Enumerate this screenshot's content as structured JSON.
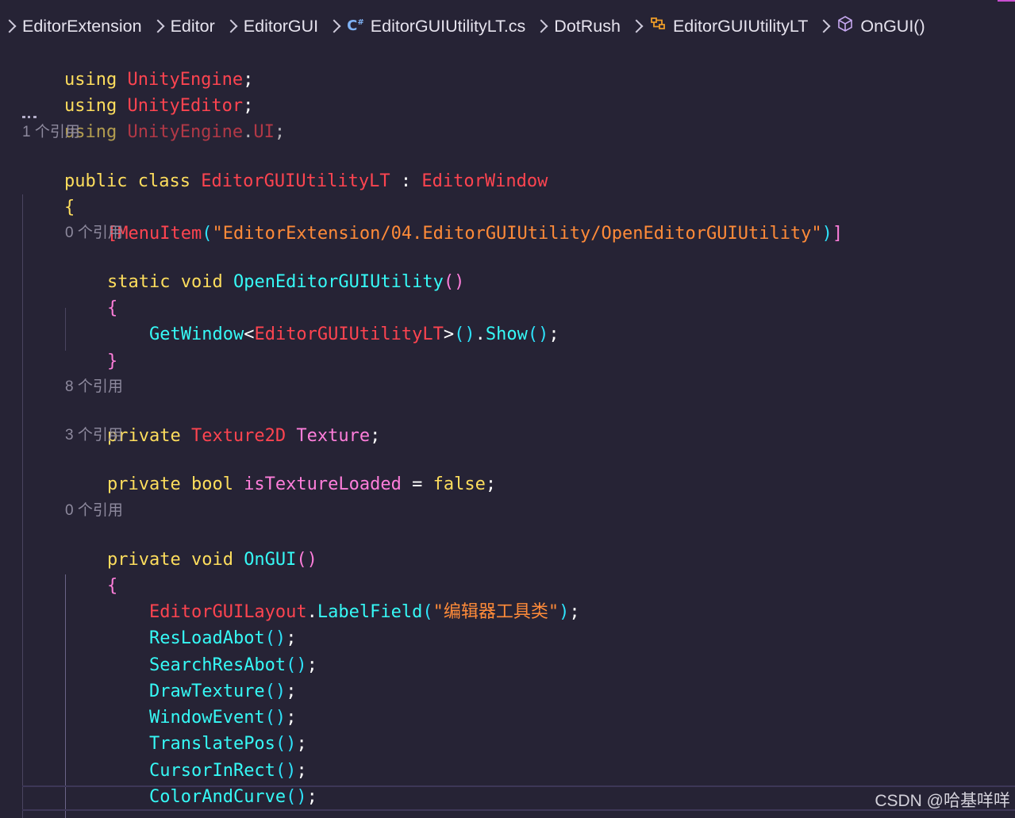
{
  "breadcrumb": {
    "items": [
      "EditorExtension",
      "Editor",
      "EditorGUI",
      "EditorGUIUtilityLT.cs",
      "DotRush",
      "EditorGUIUtilityLT",
      "OnGUI()"
    ],
    "icons": {
      "file": "csharp-file-icon",
      "class": "class-icon",
      "method": "method-cube-icon"
    }
  },
  "code": {
    "using1": {
      "kw": "using",
      "ns": "UnityEngine",
      "end": ";"
    },
    "using2": {
      "kw": "using",
      "ns": "UnityEditor",
      "end": ";"
    },
    "using3": {
      "kw": "using",
      "ns_a": "UnityEngine",
      "dot": ".",
      "ns_b": "UI",
      "end": ";"
    },
    "lens_class": "1 个引用",
    "class_decl": {
      "kw1": "public",
      "kw2": "class",
      "name": "EditorGUIUtilityLT",
      "colon": " : ",
      "base": "EditorWindow"
    },
    "open_brace": "{",
    "attr": {
      "open": "[",
      "name": "MenuItem",
      "paren_open": "(",
      "string": "\"EditorExtension/04.EditorGUIUtility/OpenEditorGUIUtility\"",
      "paren_close": ")",
      "close": "]"
    },
    "lens_open": "0 个引用",
    "open_method": {
      "kw1": "static",
      "kw2": "void",
      "name": "OpenEditorGUIUtility",
      "parens": "()"
    },
    "open_body_brace": "{",
    "getwindow": {
      "fn": "GetWindow",
      "lt": "<",
      "type": "EditorGUIUtilityLT",
      "gt": ">",
      "parens1": "()",
      "dot": ".",
      "fn2": "Show",
      "parens2": "()",
      "end": ";"
    },
    "open_body_close": "}",
    "lens_texture": "8 个引用",
    "texture_field": {
      "kw": "private",
      "type": "Texture2D",
      "name": "Texture",
      "end": ";"
    },
    "lens_loaded": "3 个引用",
    "loaded_field": {
      "kw1": "private",
      "kw2": "bool",
      "name": "isTextureLoaded",
      "eq": " = ",
      "val": "false",
      "end": ";"
    },
    "lens_ongui": "0 个引用",
    "ongui_decl": {
      "kw1": "private",
      "kw2": "void",
      "name": "OnGUI",
      "parens": "()"
    },
    "ongui_brace": "{",
    "label": {
      "cls": "EditorGUILayout",
      "dot": ".",
      "fn": "LabelField",
      "paren_open": "(",
      "string": "\"编辑器工具类\"",
      "paren_close": ")",
      "end": ";"
    },
    "calls": [
      "ResLoadAbot",
      "SearchResAbot",
      "DrawTexture",
      "WindowEvent",
      "TranslatePos",
      "CursorInRect",
      "ColorAndCurve"
    ],
    "call_parens": "()",
    "call_end": ";"
  },
  "watermark": "CSDN @哈基咩咩"
}
